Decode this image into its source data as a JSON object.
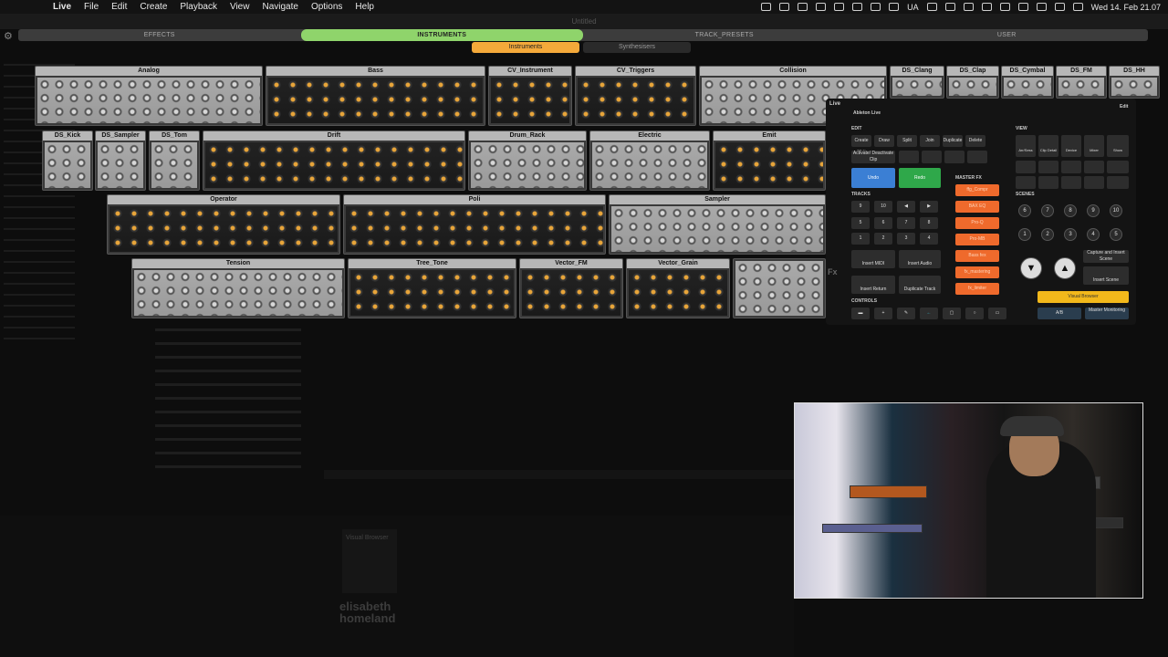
{
  "menubar": {
    "app": "Live",
    "items": [
      "File",
      "Edit",
      "Create",
      "Playback",
      "View",
      "Navigate",
      "Options",
      "Help"
    ],
    "status_text": "UA",
    "datetime": "Wed 14. Feb 21.07"
  },
  "window": {
    "title": "Untitled"
  },
  "browser_tabs": {
    "tabs": [
      "EFFECTS",
      "INSTRUMENTS",
      "TRACK_PRESETS",
      "USER"
    ],
    "active": "INSTRUMENTS"
  },
  "sub_tabs": {
    "tabs": [
      "Instruments",
      "Synthesisers"
    ],
    "active": "Instruments"
  },
  "devices": [
    "Analog",
    "Bass",
    "CV_Instrument",
    "CV_Triggers",
    "Collision",
    "DS_Clang",
    "DS_Clap",
    "DS_Cymbal",
    "DS_FM",
    "DS_HH",
    "DS_Kick",
    "DS_Sampler",
    "DS_Tom",
    "Drift",
    "Drum_Rack",
    "Electric",
    "Emit",
    "Operator",
    "Poli",
    "Sampler",
    "Tension",
    "Tree_Tone",
    "Vector_FM",
    "Vector_Grain"
  ],
  "remote": {
    "app_label": "Live",
    "subtitle": "Ableton Live",
    "sections": {
      "edit": "EDIT",
      "view": "VIEW",
      "tracks": "TRACKS",
      "scenes": "SCENES",
      "master_fx": "MASTER FX",
      "controls": "CONTROLS"
    },
    "edit_buttons": [
      "Create Midi",
      "Draw",
      "Split",
      "Join",
      "Duplicate",
      "Delete"
    ],
    "activate_label": "Activate/ Deactivate Clip",
    "undo": "Undo",
    "redo": "Redo",
    "view_buttons": [
      "Arr/Sess View",
      "Clip Detail",
      "Device",
      "Mixer",
      "Show Browser"
    ],
    "master_fx": [
      "ffg_Compr",
      "BAX EQ",
      "Pro-Q",
      "Pro-MB",
      "Bass fex",
      "fx_mastering",
      "fx_limiter"
    ],
    "track_numbers": [
      "9",
      "10",
      "5",
      "6",
      "7",
      "8",
      "1",
      "2",
      "3",
      "4"
    ],
    "scene_numbers": [
      "6",
      "7",
      "8",
      "9",
      "10",
      "1",
      "2",
      "3",
      "4",
      "5"
    ],
    "insert_midi": "Insert MIDI",
    "insert_audio": "Insert Audio",
    "insert_return": "Insert Return",
    "duplicate_track": "Duplicate Track",
    "capture_label": "Capture and Insert Scene",
    "insert_scene": "Insert Scene",
    "visual_browser": "Visual Browser",
    "ab": "A/B",
    "master_monitoring": "Master Monitoring",
    "fx_label": "Fx",
    "edit_label": "Edit"
  },
  "bottom": {
    "visual_browser_label": "Visual Browser",
    "watermark_line1": "elisabeth",
    "watermark_line2": "homeland"
  },
  "colors": {
    "accent_green": "#8fd46b",
    "accent_orange": "#f4a93a",
    "fx_orange": "#ef6a2c",
    "undo_blue": "#3b7fd4",
    "redo_green": "#2fa84a",
    "visual_yellow": "#f2b81b"
  }
}
